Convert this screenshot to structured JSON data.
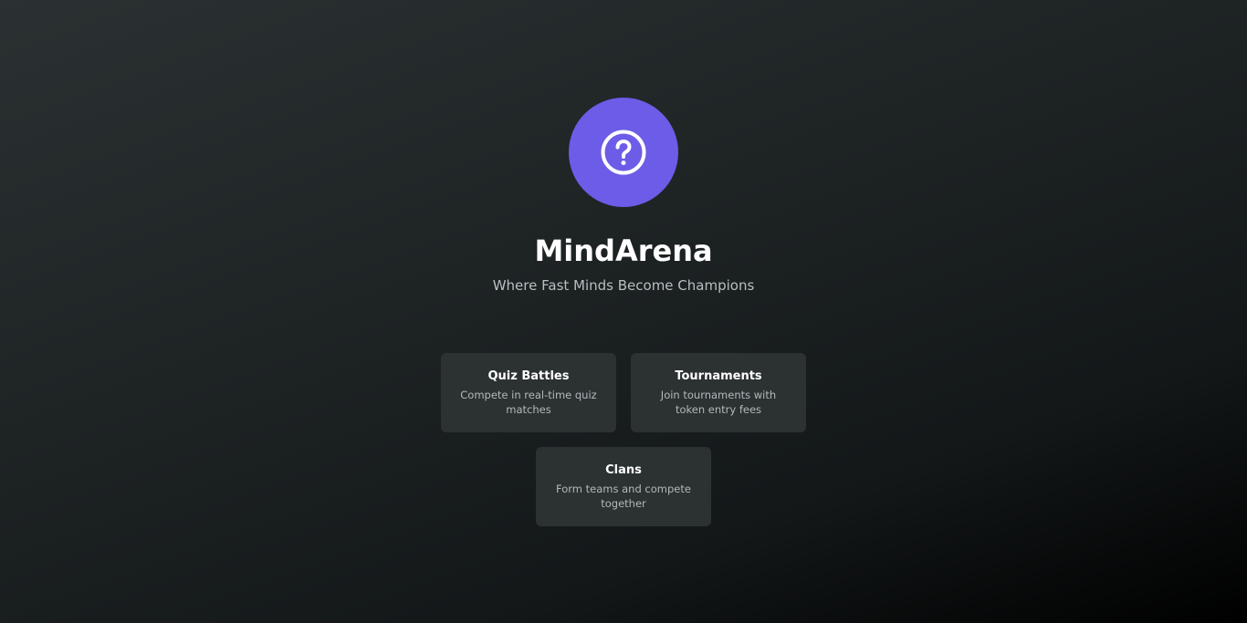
{
  "app": {
    "title": "MindArena",
    "tagline": "Where Fast Minds Become Champions",
    "logo_icon": "question-circle-icon",
    "accent_color": "#6c5ce7"
  },
  "features": [
    {
      "title": "Quiz Battles",
      "description": "Compete in real-time quiz matches"
    },
    {
      "title": "Tournaments",
      "description": "Join tournaments with token entry fees"
    },
    {
      "title": "Clans",
      "description": "Form teams and compete together"
    }
  ]
}
